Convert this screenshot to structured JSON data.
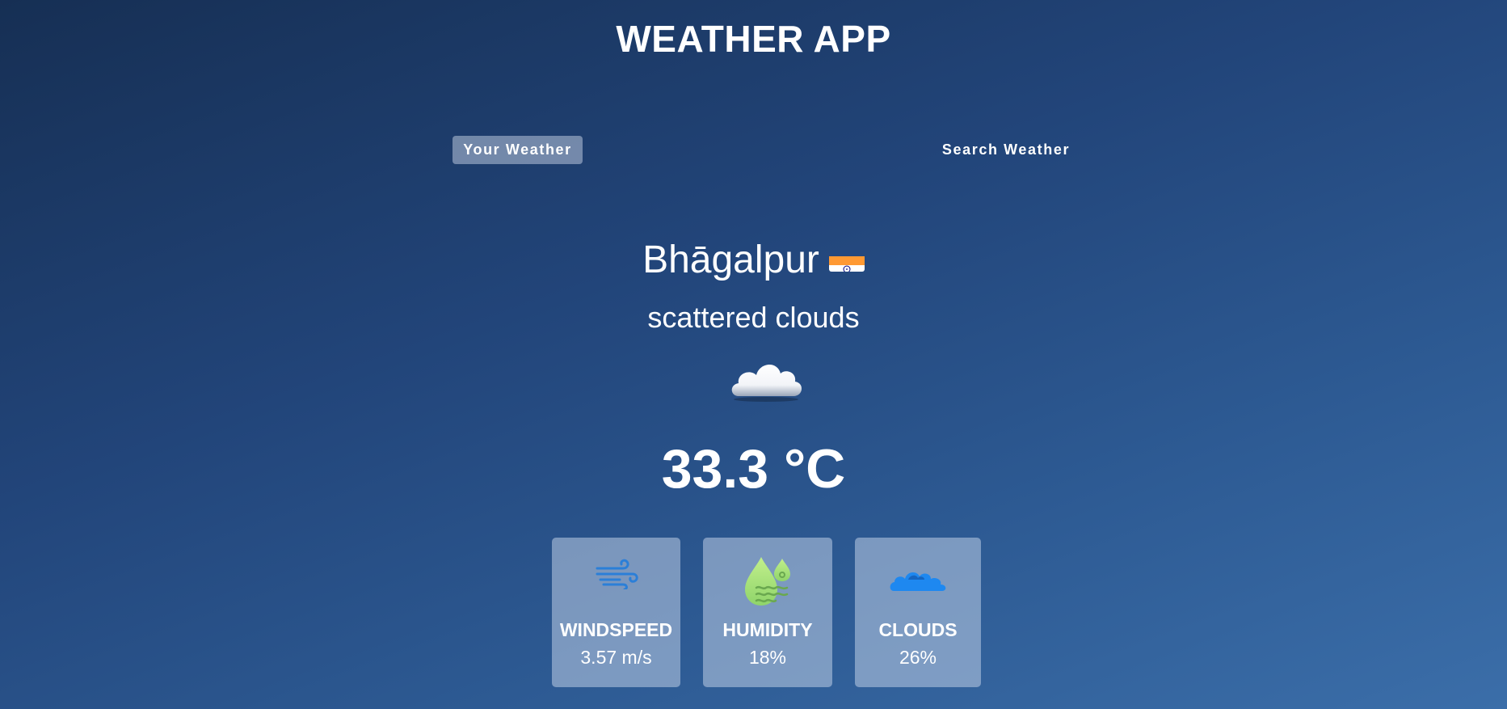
{
  "app": {
    "title": "WEATHER APP"
  },
  "tabs": [
    {
      "label": "Your Weather",
      "active": true
    },
    {
      "label": "Search Weather",
      "active": false
    }
  ],
  "location": {
    "city": "Bhāgalpur",
    "flag_icon": "india-flag-icon"
  },
  "weather": {
    "description": "scattered clouds",
    "icon": "cloud-icon",
    "temperature": "33.3 °C"
  },
  "stats": {
    "windspeed": {
      "label": "WINDSPEED",
      "value": "3.57 m/s",
      "icon": "wind-icon"
    },
    "humidity": {
      "label": "HUMIDITY",
      "value": "18%",
      "icon": "humidity-icon"
    },
    "clouds": {
      "label": "CLOUDS",
      "value": "26%",
      "icon": "clouds-icon"
    }
  },
  "colors": {
    "background_top": "#162f54",
    "background_bottom": "#3b6ea9",
    "active_tab": "#8fa0bd",
    "card": "#8aa2c3",
    "wind_icon": "#2b7fd8",
    "humidity_icon": "#a5e07a",
    "clouds_icon": "#1e88f0"
  }
}
